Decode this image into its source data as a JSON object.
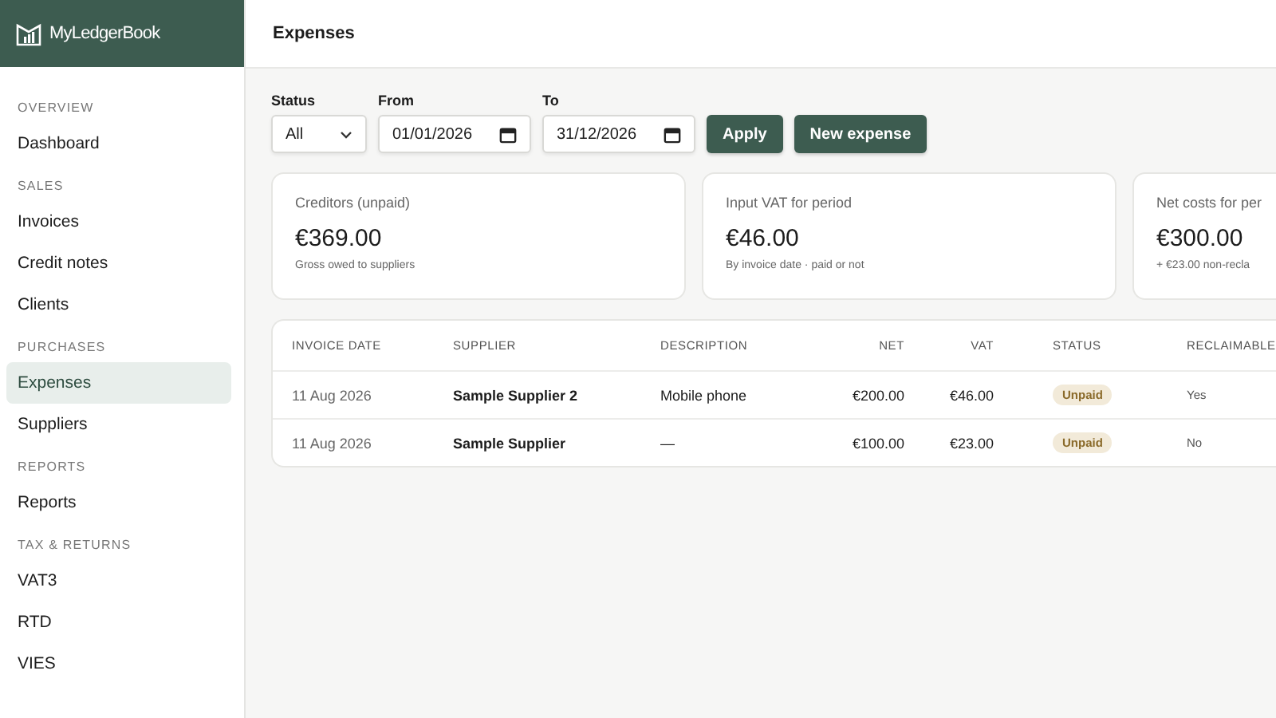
{
  "brand": {
    "name": "MyLedgerBook"
  },
  "sidebar": {
    "sections": [
      {
        "heading": "OVERVIEW",
        "items": [
          {
            "label": "Dashboard",
            "selected": false
          }
        ]
      },
      {
        "heading": "SALES",
        "items": [
          {
            "label": "Invoices",
            "selected": false
          },
          {
            "label": "Credit notes",
            "selected": false
          },
          {
            "label": "Clients",
            "selected": false
          }
        ]
      },
      {
        "heading": "PURCHASES",
        "items": [
          {
            "label": "Expenses",
            "selected": true
          },
          {
            "label": "Suppliers",
            "selected": false
          }
        ]
      },
      {
        "heading": "REPORTS",
        "items": [
          {
            "label": "Reports",
            "selected": false
          }
        ]
      },
      {
        "heading": "TAX & RETURNS",
        "items": [
          {
            "label": "VAT3",
            "selected": false
          },
          {
            "label": "RTD",
            "selected": false
          },
          {
            "label": "VIES",
            "selected": false
          }
        ]
      }
    ]
  },
  "page_title": "Expenses",
  "filters": {
    "status": {
      "label": "Status",
      "value": "All"
    },
    "from": {
      "label": "From",
      "value": "01/01/2026"
    },
    "to": {
      "label": "To",
      "value": "31/12/2026"
    }
  },
  "buttons": [
    {
      "label": "Apply"
    },
    {
      "label": "New expense"
    }
  ],
  "cards": [
    {
      "title": "Creditors (unpaid)",
      "value": "€369.00",
      "note": "Gross owed to suppliers"
    },
    {
      "title": "Input VAT for period",
      "value": "€46.00",
      "note": "By invoice date · paid or not"
    },
    {
      "title": "Net costs for per",
      "value": "€300.00",
      "note": "+ €23.00 non-recla"
    }
  ],
  "table": {
    "columns": [
      {
        "label": "INVOICE DATE",
        "kind": "text"
      },
      {
        "label": "SUPPLIER",
        "kind": "text"
      },
      {
        "label": "DESCRIPTION",
        "kind": "text"
      },
      {
        "label": "NET",
        "kind": "amount"
      },
      {
        "label": "VAT",
        "kind": "amount"
      },
      {
        "label": "STATUS",
        "kind": "text"
      },
      {
        "label": "RECLAIMABLE",
        "kind": "text"
      }
    ],
    "rows": [
      {
        "invoice_date": "11 Aug 2026",
        "supplier": "Sample Supplier 2",
        "description": "Mobile phone",
        "net": "€200.00",
        "vat": "€46.00",
        "status": "Unpaid",
        "reclaimable": "Yes"
      },
      {
        "invoice_date": "11 Aug 2026",
        "supplier": "Sample Supplier",
        "description": "—",
        "net": "€100.00",
        "vat": "€23.00",
        "status": "Unpaid",
        "reclaimable": "No"
      }
    ]
  }
}
